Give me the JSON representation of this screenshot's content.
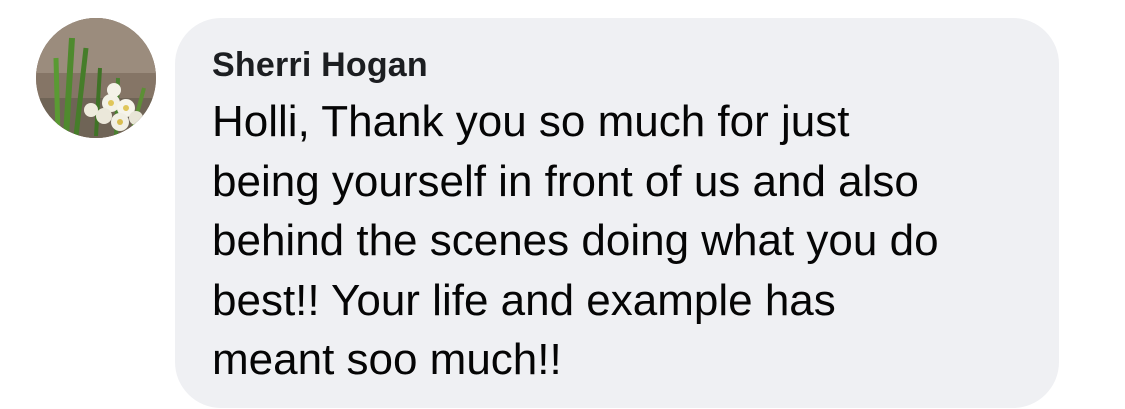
{
  "comment": {
    "author": "Sherri Hogan",
    "avatar_icon": "daffodil-photo",
    "text": "Holli,  Thank you so much for just\nbeing yourself in front of us and also\nbehind the scenes doing what you do\nbest!!  Your life and example has\nmeant soo much!!",
    "bubble_color": "#eff0f3"
  }
}
